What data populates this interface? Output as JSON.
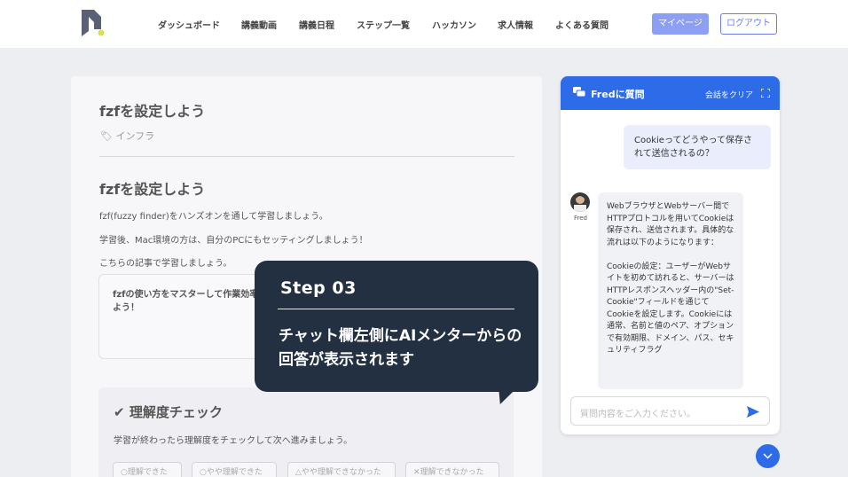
{
  "header": {
    "nav": [
      "ダッシュボード",
      "講義動画",
      "講義日程",
      "ステップ一覧",
      "ハッカソン",
      "求人情報",
      "よくある質問"
    ],
    "mypage_label": "マイページ",
    "logout_label": "ログアウト"
  },
  "article": {
    "title": "fzfを設定しよう",
    "tag": "インフラ",
    "subtitle": "fzfを設定しよう",
    "p1": "fzf(fuzzy finder)をハンズオンを通して学習しましょう。",
    "p2": "学習後、Mac環境の方は、自分のPCにもセッティングしましょう！",
    "p3": "こちらの記事で学習しましょう。",
    "link_text": "fzfの使い方をマスターして作業効率を上げよう！"
  },
  "check": {
    "title": "理解度チェック",
    "desc": "学習が終わったら理解度をチェックして次へ進みましょう。",
    "options": [
      "○理解できた",
      "○やや理解できた",
      "△やや理解できなかった",
      "✕理解できなかった"
    ]
  },
  "chat": {
    "title": "Fredに質問",
    "clear_label": "会話をクリア",
    "user_message": "Cookieってどうやって保存されて送信されるの？",
    "ai_name": "Fred",
    "ai_message": "WebブラウザとWebサーバー間でHTTPプロトコルを用いてCookieは保存され、送信されます。具体的な流れは以下のようになります：\n\nCookieの設定：ユーザーがWebサイトを初めて訪れると、サーバーはHTTPレスポンスヘッダー内の\"Set-Cookie\"フィールドを通じてCookieを設定します。Cookieには通常、名前と値のペア、オプションで有効期限、ドメイン、パス、セキュリティフラグ",
    "input_placeholder": "質問内容をご入力ください。"
  },
  "step": {
    "label": "Step 03",
    "text": "チャット欄左側にAIメンターからの回答が表示されます"
  },
  "colors": {
    "primary": "#2d6be8",
    "overlay": "#223041",
    "mypage_bg": "#8d9ff2"
  }
}
